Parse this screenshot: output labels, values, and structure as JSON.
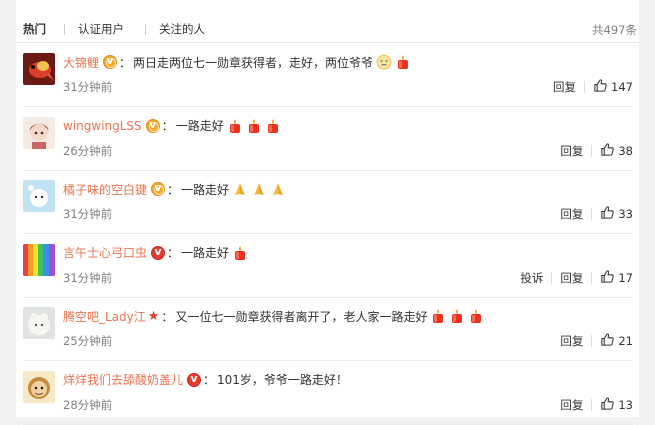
{
  "tabs": [
    {
      "label": "热门"
    },
    {
      "label": "认证用户"
    },
    {
      "label": "关注的人"
    }
  ],
  "total": "共497条",
  "actions": {
    "reply": "回复",
    "report": "投诉"
  },
  "comments": [
    {
      "user": "大锦鲤",
      "badge": "gold",
      "text": "两日走两位七一勋章获得者，走好，两位爷爷",
      "emojis": [
        "sad",
        "candle"
      ],
      "time": "31分钟前",
      "likes": "147",
      "report": false
    },
    {
      "user": "wingwingLSS",
      "badge": "gold",
      "text": "一路走好",
      "emojis": [
        "candle",
        "candle",
        "candle"
      ],
      "time": "26分钟前",
      "likes": "38",
      "report": false
    },
    {
      "user": "橘子味的空白键",
      "badge": "gold",
      "text": "一路走好",
      "emojis": [
        "pray",
        "pray",
        "pray"
      ],
      "time": "31分钟前",
      "likes": "33",
      "report": false
    },
    {
      "user": "言午士心弓口虫",
      "badge": "red",
      "text": "一路走好",
      "emojis": [
        "candle"
      ],
      "time": "31分钟前",
      "likes": "17",
      "report": true
    },
    {
      "user": "腾空吧_Lady江",
      "badge": "star",
      "text": "又一位七一勋章获得者离开了，老人家一路走好",
      "emojis": [
        "candle",
        "candle",
        "candle"
      ],
      "time": "25分钟前",
      "likes": "21",
      "report": false
    },
    {
      "user": "烊烊我们去舔酸奶盖儿",
      "badge": "red",
      "text": "101岁，爷爷一路走好！",
      "emojis": [],
      "time": "28分钟前",
      "likes": "13",
      "report": false
    }
  ]
}
